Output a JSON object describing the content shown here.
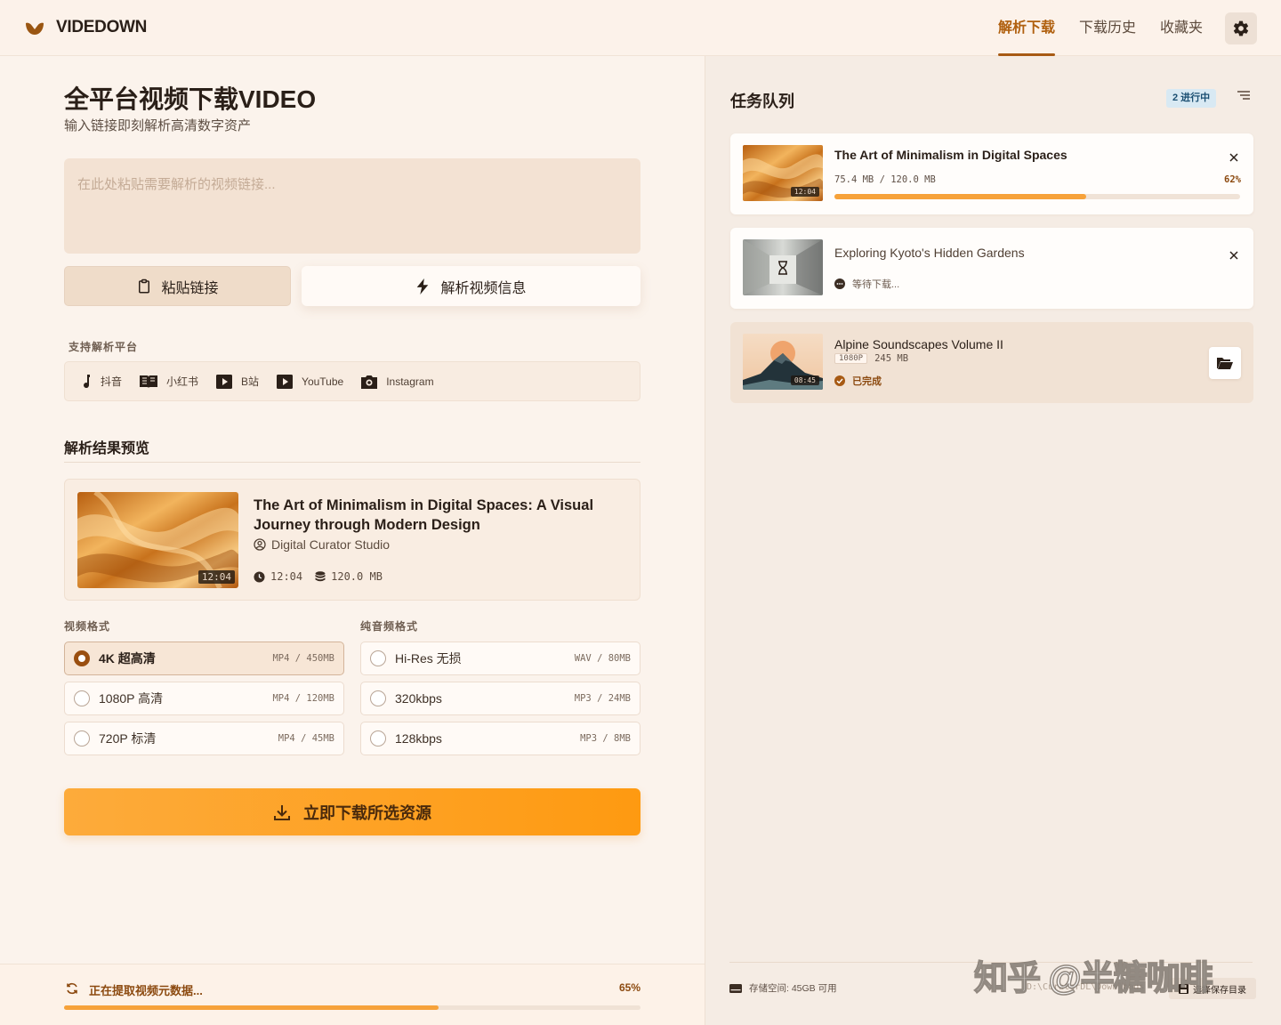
{
  "app": {
    "name": "VIDEDOWN"
  },
  "nav": {
    "items": [
      "解析下载",
      "下载历史",
      "收藏夹"
    ],
    "active": 0
  },
  "main": {
    "title": "全平台视频下载VIDEO",
    "subtitle": "输入链接即刻解析高清数字资产",
    "url_placeholder": "在此处粘贴需要解析的视频链接...",
    "url_value": "",
    "paste_label": "粘贴链接",
    "parse_label": "解析视频信息",
    "platforms_label": "支持解析平台",
    "platforms": [
      {
        "name": "抖音",
        "icon": "music-note-icon"
      },
      {
        "name": "小红书",
        "icon": "book-icon"
      },
      {
        "name": "B站",
        "icon": "play-icon"
      },
      {
        "name": "YouTube",
        "icon": "youtube-icon"
      },
      {
        "name": "Instagram",
        "icon": "camera-icon"
      }
    ],
    "result_label": "解析结果预览",
    "result": {
      "title": "The Art of Minimalism in Digital Spaces: A Visual Journey through Modern Design",
      "author": "Digital Curator Studio",
      "duration": "12:04",
      "size": "120.0 MB"
    },
    "video_format_label": "视频格式",
    "audio_format_label": "纯音频格式",
    "video_formats": [
      {
        "label": "4K 超高清",
        "meta": "MP4 / 450MB",
        "selected": true
      },
      {
        "label": "1080P 高清",
        "meta": "MP4 / 120MB",
        "selected": false
      },
      {
        "label": "720P 标清",
        "meta": "MP4 / 45MB",
        "selected": false
      }
    ],
    "audio_formats": [
      {
        "label": "Hi-Res 无损",
        "meta": "WAV / 80MB",
        "selected": false
      },
      {
        "label": "320kbps",
        "meta": "MP3 / 24MB",
        "selected": false
      },
      {
        "label": "128kbps",
        "meta": "MP3 / 8MB",
        "selected": false
      }
    ],
    "download_label": "立即下载所选资源"
  },
  "status_bar": {
    "text": "正在提取视频元数据...",
    "percent_label": "65%",
    "progress": 0.65
  },
  "queue": {
    "title": "任务队列",
    "badge": "2 进行中",
    "tasks": [
      {
        "title": "The Art of Minimalism in Digital Spaces",
        "duration": "12:04",
        "size_text": "75.4 MB / 120.0 MB",
        "percent_label": "62%",
        "progress": 0.62,
        "state": "downloading"
      },
      {
        "title": "Exploring Kyoto's Hidden Gardens",
        "state_text": "等待下载...",
        "state": "waiting"
      },
      {
        "title": "Alpine Soundscapes Volume II",
        "duration": "08:45",
        "resolution": "1080P",
        "size": "245 MB",
        "state_text": "已完成",
        "state": "done"
      }
    ]
  },
  "footer": {
    "storage": "存储空间: 45GB 可用",
    "path": "D:\\CuratorDL\\Downloads",
    "choose_label": "选择保存目录"
  },
  "watermark": "知乎 @半糖咖啡",
  "colors": {
    "accent": "#a75a14",
    "button_orange": "#fe9a11",
    "progress": "#f7a23a",
    "background": "#fbf3ec"
  }
}
